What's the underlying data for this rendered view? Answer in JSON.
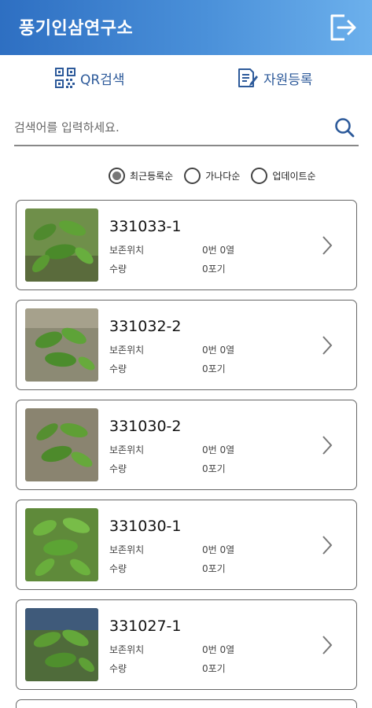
{
  "header": {
    "title": "풍기인삼연구소",
    "logout_icon": "logout-icon"
  },
  "tabs": [
    {
      "label": "QR검색",
      "icon": "qr-code-icon"
    },
    {
      "label": "자원등록",
      "icon": "edit-document-icon"
    }
  ],
  "search": {
    "placeholder": "검색어를 입력하세요.",
    "value": "",
    "icon": "search-icon"
  },
  "sort": {
    "options": [
      {
        "label": "최근등록순",
        "selected": true
      },
      {
        "label": "가나다순",
        "selected": false
      },
      {
        "label": "업데이트순",
        "selected": false
      }
    ]
  },
  "labels": {
    "location": "보존위치",
    "quantity": "수량"
  },
  "items": [
    {
      "id": "331033-1",
      "location": "0번 0열",
      "quantity": "0포기"
    },
    {
      "id": "331032-2",
      "location": "0번 0열",
      "quantity": "0포기"
    },
    {
      "id": "331030-2",
      "location": "0번 0열",
      "quantity": "0포기"
    },
    {
      "id": "331030-1",
      "location": "0번 0열",
      "quantity": "0포기"
    },
    {
      "id": "331027-1",
      "location": "0번 0열",
      "quantity": "0포기"
    }
  ],
  "colors": {
    "header_start": "#2e6fc2",
    "header_end": "#6cb0ec",
    "tab_text": "#2d5a9a",
    "accent": "#2d5a9a"
  }
}
